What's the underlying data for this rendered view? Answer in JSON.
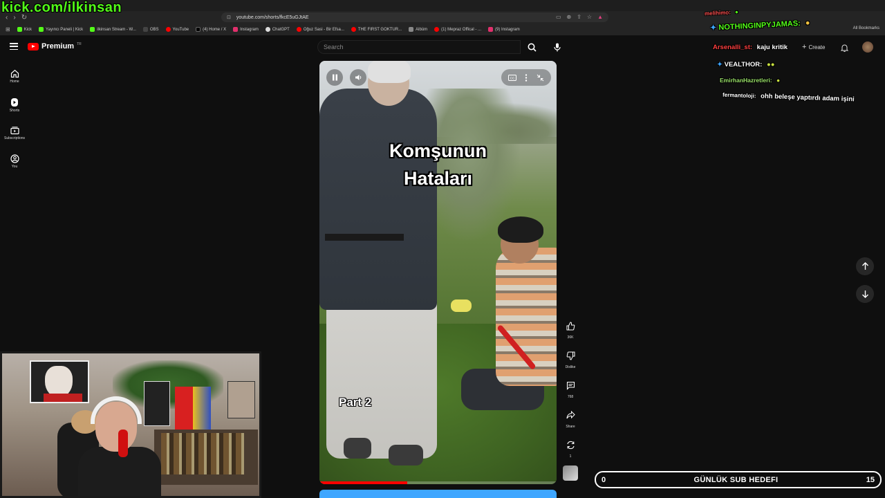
{
  "overlay": {
    "kick_url": "kick.com/ilkinsan"
  },
  "browser": {
    "url": "youtube.com/shorts/fkcE5uGJtAE",
    "bookmarks": [
      {
        "label": "Kick",
        "color": "#53fc18"
      },
      {
        "label": "Yayıncı Paneli | Kick",
        "color": "#53fc18"
      },
      {
        "label": "ilkinsan Stream - W...",
        "color": "#53fc18"
      },
      {
        "label": "OBS",
        "color": "#444444"
      },
      {
        "label": "YouTube",
        "color": "#ff0000"
      },
      {
        "label": "(4) Home / X",
        "color": "#000000"
      },
      {
        "label": "Instagram",
        "color": "#e1306c"
      },
      {
        "label": "ChatGPT",
        "color": "#dddddd"
      },
      {
        "label": "Oğuz Sasi - Bir Efsa...",
        "color": "#ff0000"
      },
      {
        "label": "THE FIRST GOKTUR...",
        "color": "#ff0000"
      },
      {
        "label": "Albüm",
        "color": "#888888"
      },
      {
        "label": "(1) Mepraz Offical - ...",
        "color": "#ff0000"
      },
      {
        "label": "(9) Instagram",
        "color": "#e1306c"
      }
    ],
    "all_bookmarks": "All Bookmarks"
  },
  "youtube": {
    "logo_text": "Premium",
    "logo_tr": "TR",
    "search_placeholder": "Search",
    "create_label": "Create",
    "nav": [
      {
        "label": "Home",
        "icon": "home-icon"
      },
      {
        "label": "Shorts",
        "icon": "shorts-icon"
      },
      {
        "label": "Subscriptions",
        "icon": "subscriptions-icon"
      },
      {
        "label": "You",
        "icon": "you-icon"
      }
    ]
  },
  "video": {
    "caption_line1": "Komşunun",
    "caption_line2": "Hataları",
    "part_label": "Part 2",
    "progress": 0.37
  },
  "actions": {
    "likes": "36K",
    "dislike": "Dislike",
    "comments": "768",
    "share": "Share",
    "remix": "1"
  },
  "chat": [
    {
      "user": "melihimo:",
      "user_color": "#ff5050",
      "text": ""
    },
    {
      "user": "NOTHINGINPYJAMAS:",
      "user_color": "#53fc18",
      "text": ""
    },
    {
      "user": "Arsenalli_st:",
      "user_color": "#ff4040",
      "text": "kaju kritik"
    },
    {
      "user": "VEALTHOR:",
      "user_color": "#ffffff",
      "text": ""
    },
    {
      "user": "EmirhanHazretleri:",
      "user_color": "#9be36a",
      "text": ""
    },
    {
      "user": "fermantoloji:",
      "user_color": "#ffffff",
      "text": "ohh beleşe yaptırdı adam işini"
    }
  ],
  "subgoal": {
    "current": "0",
    "label": "GÜNLÜK SUB HEDEFI",
    "target": "15"
  }
}
